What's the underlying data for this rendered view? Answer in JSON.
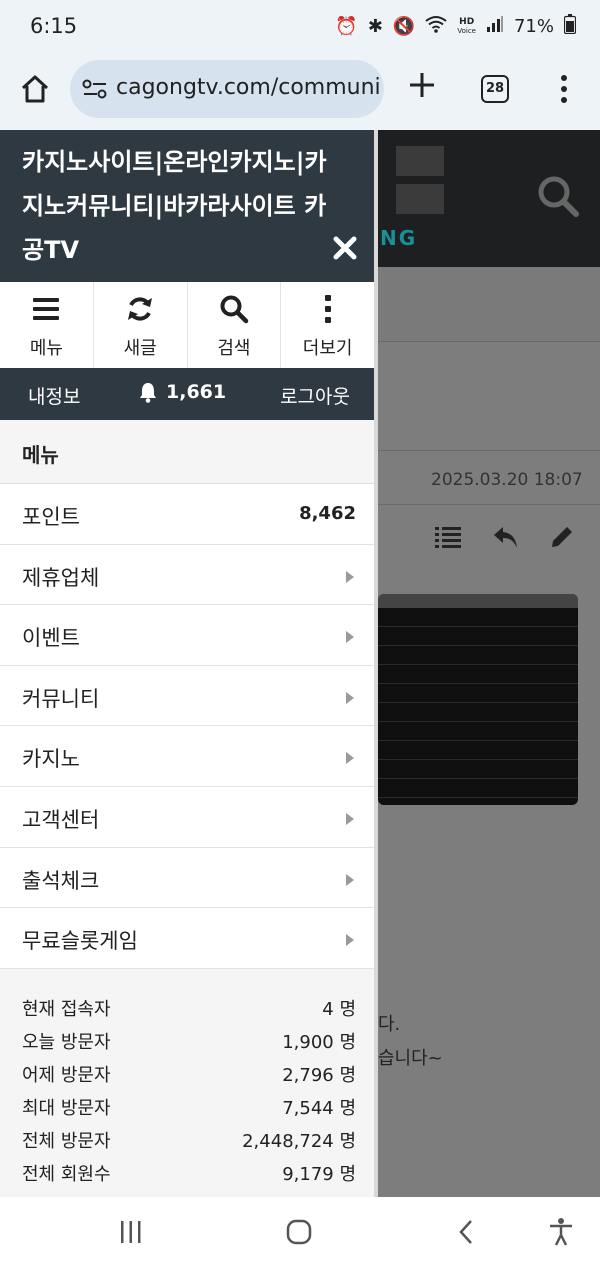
{
  "status_bar": {
    "time": "6:15",
    "hd_label": "HD",
    "voice_label": "Voice",
    "battery": "71%"
  },
  "browser": {
    "url": "cagongtv.com/communi",
    "tab_count": "28"
  },
  "background_page": {
    "logo_text": "NG",
    "date": "2025.03.20 18:07",
    "text_line1": "다.",
    "text_line2": "습니다~"
  },
  "drawer": {
    "title": "카지노사이트|온라인카지노|카지노커뮤니티|바카라사이트 카공TV",
    "quick_actions": [
      {
        "label": "메뉴",
        "icon": "hamburger-icon"
      },
      {
        "label": "새글",
        "icon": "refresh-icon"
      },
      {
        "label": "검색",
        "icon": "search-icon"
      },
      {
        "label": "더보기",
        "icon": "vertical-dots-icon"
      }
    ],
    "user_bar": {
      "my_info": "내정보",
      "notifications": "1,661",
      "logout": "로그아웃"
    },
    "menu_header": "메뉴",
    "menu_items": [
      {
        "label": "포인트",
        "value": "8,462"
      },
      {
        "label": "제휴업체"
      },
      {
        "label": "이벤트"
      },
      {
        "label": "커뮤니티"
      },
      {
        "label": "카지노"
      },
      {
        "label": "고객센터"
      },
      {
        "label": "출석체크"
      },
      {
        "label": "무료슬롯게임"
      }
    ],
    "stats": [
      {
        "label": "현재 접속자",
        "value": "4 명"
      },
      {
        "label": "오늘 방문자",
        "value": "1,900 명"
      },
      {
        "label": "어제 방문자",
        "value": "2,796 명"
      },
      {
        "label": "최대 방문자",
        "value": "7,544 명"
      },
      {
        "label": "전체 방문자",
        "value": "2,448,724 명"
      },
      {
        "label": "전체 회원수",
        "value": "9,179 명"
      }
    ]
  },
  "colors": {
    "drawer_header": "#2f3942",
    "chrome_bg": "#eef3f8",
    "url_bar": "#d6e3ee",
    "overlay": "#7d7d7d"
  }
}
